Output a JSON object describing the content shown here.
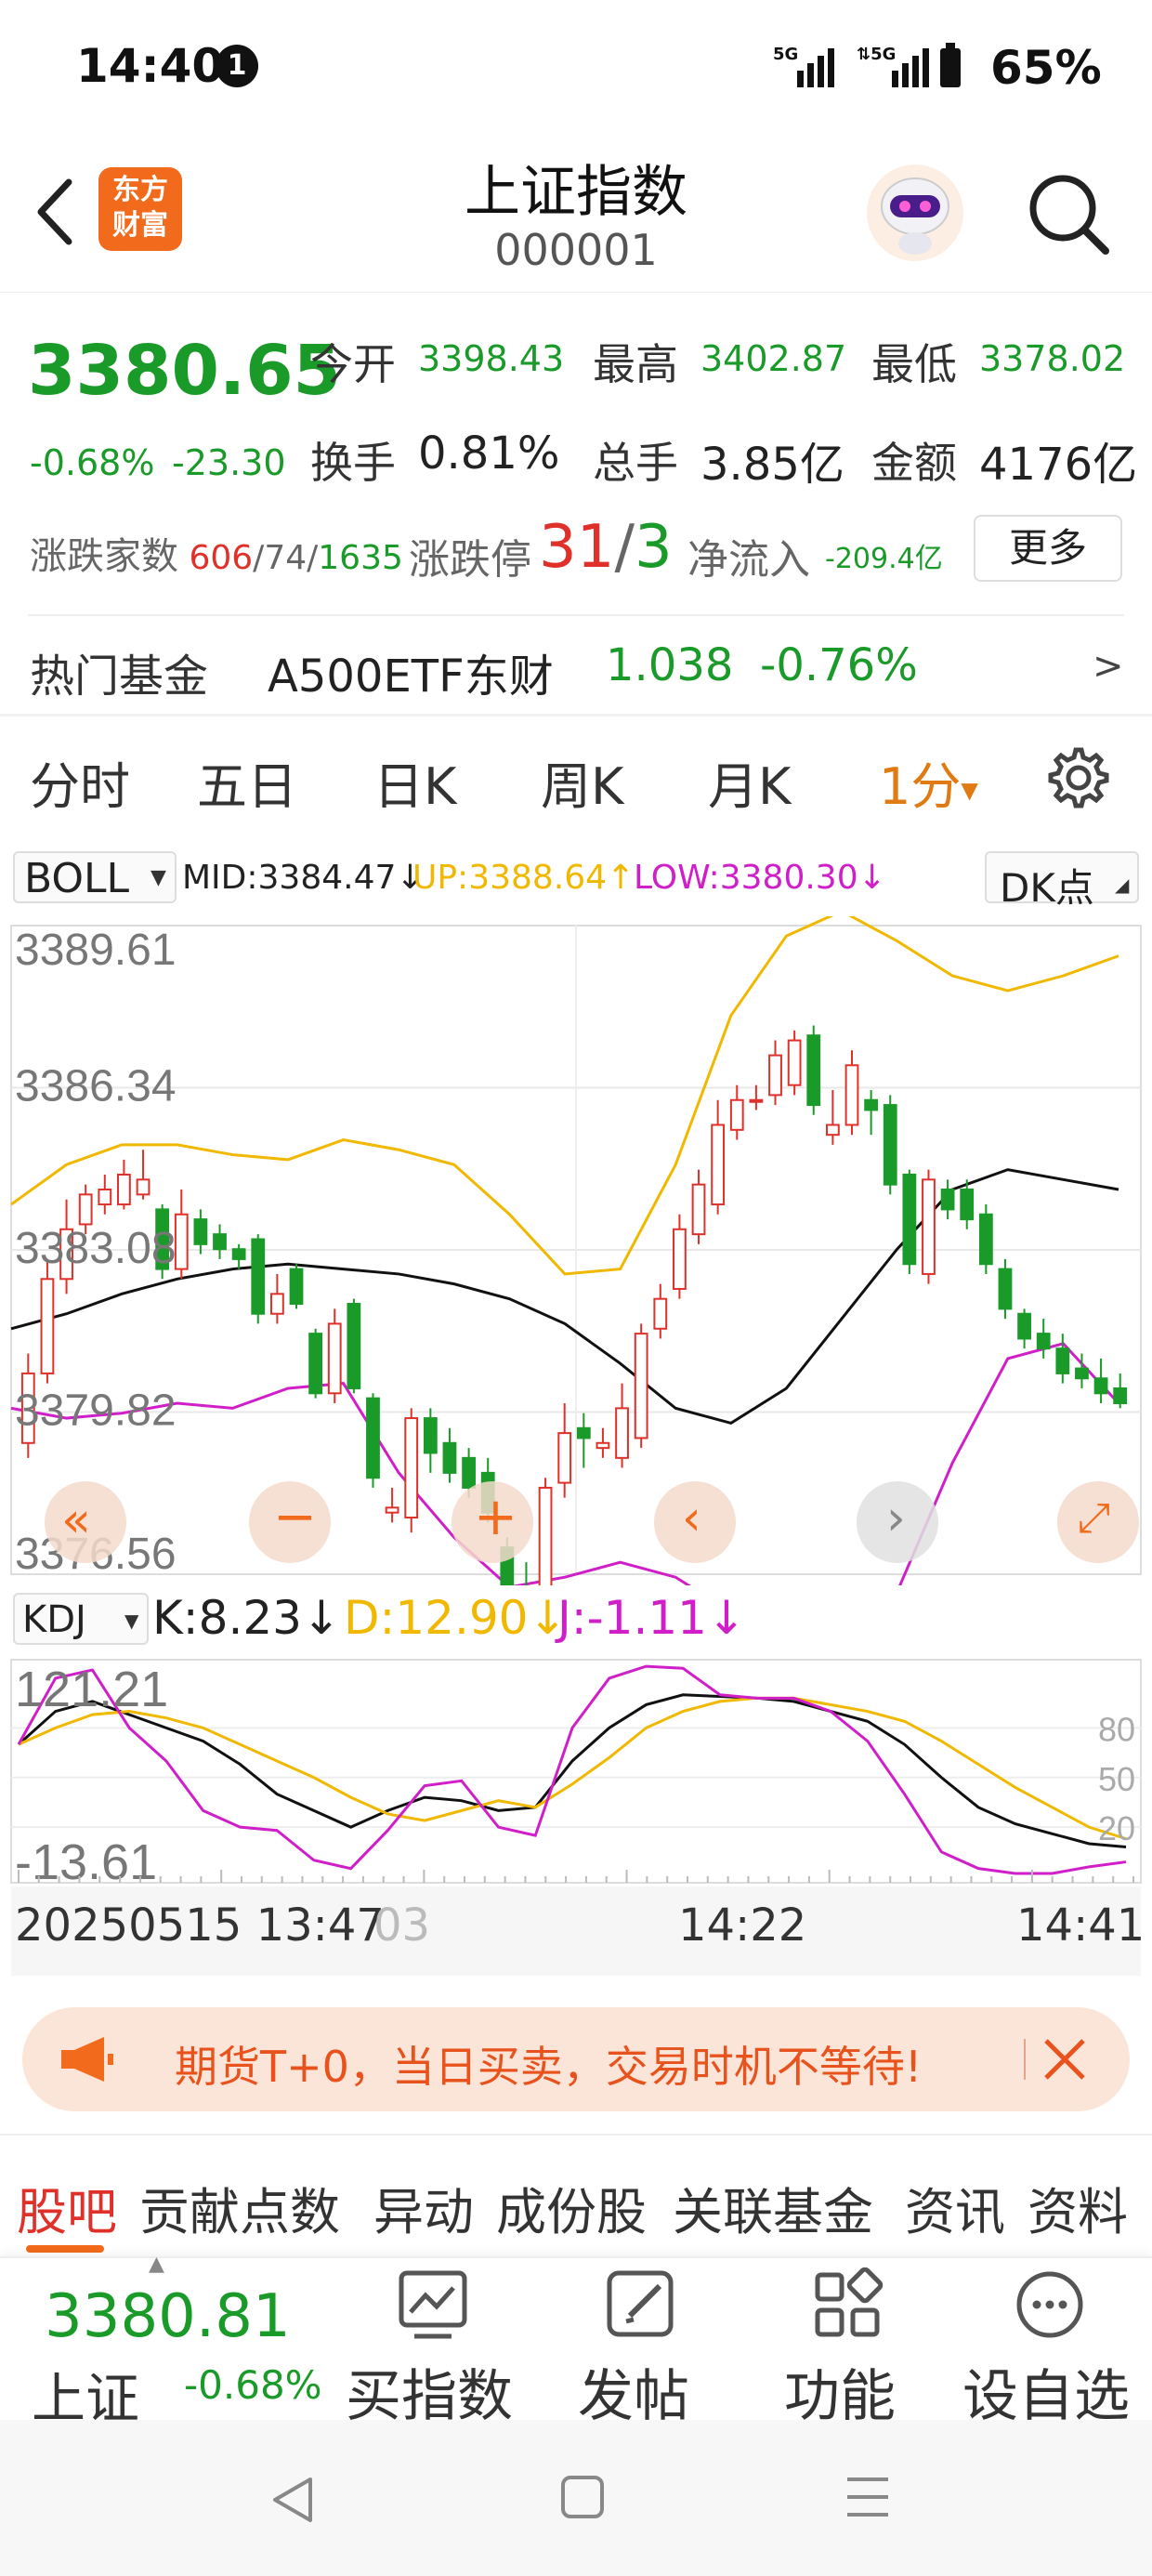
{
  "status": {
    "time": "14:40",
    "notif": "1",
    "net1": "5G",
    "net2": "5G",
    "battery": "65%"
  },
  "header": {
    "title": "上证指数",
    "code": "000001",
    "logo_line1": "东方",
    "logo_line2": "财富"
  },
  "quote": {
    "price": "3380.65",
    "change_pct": "-0.68%",
    "change": "-23.30",
    "open_label": "今开",
    "open": "3398.43",
    "high_label": "最高",
    "high": "3402.87",
    "low_label": "最低",
    "low": "3378.02",
    "turnover_label": "换手",
    "turnover": "0.81%",
    "volume_label": "总手",
    "volume": "3.85亿",
    "amount_label": "金额",
    "amount": "4176亿",
    "breadth_label": "涨跌家数",
    "up_count": "606",
    "flat_count": "74",
    "down_count": "1635",
    "sep": "/",
    "limit_label": "涨跌停",
    "limit_up": "31",
    "limit_down": "3",
    "netflow_label": "净流入",
    "netflow": "-209.4亿",
    "more_button": "更多"
  },
  "fund": {
    "label": "热门基金",
    "name": "A500ETF东财",
    "price": "1.038",
    "change": "-0.76%",
    "arrow": ">"
  },
  "tabs": [
    "分时",
    "五日",
    "日K",
    "周K",
    "月K",
    "1分"
  ],
  "tab_active_marker": "▼",
  "boll": {
    "name": "BOLL",
    "mid": "MID:3384.47↓",
    "up": "UP:3388.64↑",
    "low": "LOW:3380.30↓",
    "dk_button": "DK点"
  },
  "kdj": {
    "name": "KDJ",
    "k": "K:8.23↓",
    "d": "D:12.90↓",
    "j": "J:-1.11↓"
  },
  "time_axis": {
    "start": "20250515 13:47",
    "ghost": "03",
    "mid": "14:22",
    "end": "14:41"
  },
  "banner": {
    "text": "期货T+0，当日买卖，交易时机不等待!"
  },
  "subnav": [
    "股吧",
    "贡献点数",
    "异动",
    "成份股",
    "关联基金",
    "资讯",
    "资料"
  ],
  "bottom": {
    "price": "3380.81",
    "name": "上证",
    "change": "-0.68%",
    "items": [
      "买指数",
      "发帖",
      "功能",
      "设自选"
    ]
  },
  "colors": {
    "up": "#e0302a",
    "down": "#1a9a28",
    "mid": "#111111",
    "upper": "#f0b800",
    "lower": "#d01fc8",
    "accent": "#e07a12"
  },
  "chart_data": [
    {
      "type": "candlestick",
      "title": "BOLL",
      "yticks": [
        "3389.61",
        "3386.34",
        "3383.08",
        "3379.82",
        "3376.56"
      ],
      "ylim": [
        3376.56,
        3389.61
      ],
      "candles": [
        {
          "o": 3379.2,
          "c": 3380.6,
          "h": 3381.0,
          "l": 3378.9
        },
        {
          "o": 3380.6,
          "c": 3382.5,
          "h": 3382.9,
          "l": 3380.4
        },
        {
          "o": 3382.5,
          "c": 3383.5,
          "h": 3384.1,
          "l": 3382.2
        },
        {
          "o": 3383.6,
          "c": 3384.2,
          "h": 3384.4,
          "l": 3383.4
        },
        {
          "o": 3384.0,
          "c": 3384.3,
          "h": 3384.6,
          "l": 3383.8
        },
        {
          "o": 3384.0,
          "c": 3384.6,
          "h": 3384.9,
          "l": 3383.9
        },
        {
          "o": 3384.2,
          "c": 3384.5,
          "h": 3385.1,
          "l": 3384.1
        },
        {
          "o": 3383.9,
          "c": 3382.7,
          "h": 3384.0,
          "l": 3382.5
        },
        {
          "o": 3382.7,
          "c": 3383.8,
          "h": 3384.3,
          "l": 3382.5
        },
        {
          "o": 3383.7,
          "c": 3383.2,
          "h": 3383.9,
          "l": 3383.0
        },
        {
          "o": 3383.4,
          "c": 3383.1,
          "h": 3383.6,
          "l": 3382.9
        },
        {
          "o": 3383.1,
          "c": 3382.9,
          "h": 3383.2,
          "l": 3382.7
        },
        {
          "o": 3383.3,
          "c": 3381.8,
          "h": 3383.4,
          "l": 3381.6
        },
        {
          "o": 3381.8,
          "c": 3382.2,
          "h": 3382.6,
          "l": 3381.6
        },
        {
          "o": 3382.7,
          "c": 3382.0,
          "h": 3382.8,
          "l": 3381.9
        },
        {
          "o": 3381.4,
          "c": 3380.2,
          "h": 3381.5,
          "l": 3380.1
        },
        {
          "o": 3380.2,
          "c": 3381.6,
          "h": 3381.9,
          "l": 3380.0
        },
        {
          "o": 3382.0,
          "c": 3380.3,
          "h": 3382.1,
          "l": 3380.2
        },
        {
          "o": 3380.1,
          "c": 3378.5,
          "h": 3380.2,
          "l": 3378.3
        },
        {
          "o": 3377.8,
          "c": 3377.9,
          "h": 3378.3,
          "l": 3377.6
        },
        {
          "o": 3377.7,
          "c": 3379.7,
          "h": 3379.9,
          "l": 3377.4
        },
        {
          "o": 3379.7,
          "c": 3379.0,
          "h": 3379.9,
          "l": 3378.6
        },
        {
          "o": 3379.2,
          "c": 3378.6,
          "h": 3379.5,
          "l": 3378.4
        },
        {
          "o": 3378.9,
          "c": 3378.3,
          "h": 3379.1,
          "l": 3378.1
        },
        {
          "o": 3378.6,
          "c": 3377.8,
          "h": 3378.9,
          "l": 3377.6
        },
        {
          "o": 3377.1,
          "c": 3376.2,
          "h": 3377.3,
          "l": 3376.1
        },
        {
          "o": 3376.1,
          "c": 3375.9,
          "h": 3376.8,
          "l": 3375.8
        },
        {
          "o": 3375.8,
          "c": 3378.3,
          "h": 3378.5,
          "l": 3375.6
        },
        {
          "o": 3378.4,
          "c": 3379.4,
          "h": 3380.0,
          "l": 3378.1
        },
        {
          "o": 3379.5,
          "c": 3379.3,
          "h": 3379.8,
          "l": 3378.7
        },
        {
          "o": 3379.1,
          "c": 3379.2,
          "h": 3379.5,
          "l": 3378.9
        },
        {
          "o": 3378.9,
          "c": 3379.9,
          "h": 3380.4,
          "l": 3378.7
        },
        {
          "o": 3379.3,
          "c": 3381.4,
          "h": 3381.6,
          "l": 3379.1
        },
        {
          "o": 3381.5,
          "c": 3382.1,
          "h": 3382.4,
          "l": 3381.3
        },
        {
          "o": 3382.3,
          "c": 3383.5,
          "h": 3383.8,
          "l": 3382.1
        },
        {
          "o": 3383.4,
          "c": 3384.4,
          "h": 3384.7,
          "l": 3383.2
        },
        {
          "o": 3384.0,
          "c": 3385.6,
          "h": 3386.1,
          "l": 3383.8
        },
        {
          "o": 3385.5,
          "c": 3386.1,
          "h": 3386.4,
          "l": 3385.3
        },
        {
          "o": 3386.1,
          "c": 3386.1,
          "h": 3386.4,
          "l": 3385.9
        },
        {
          "o": 3386.2,
          "c": 3387.0,
          "h": 3387.3,
          "l": 3386.0
        },
        {
          "o": 3386.4,
          "c": 3387.3,
          "h": 3387.5,
          "l": 3386.2
        },
        {
          "o": 3387.4,
          "c": 3386.0,
          "h": 3387.6,
          "l": 3385.8
        },
        {
          "o": 3385.4,
          "c": 3385.6,
          "h": 3386.3,
          "l": 3385.2
        },
        {
          "o": 3385.6,
          "c": 3386.8,
          "h": 3387.1,
          "l": 3385.4
        },
        {
          "o": 3386.1,
          "c": 3385.9,
          "h": 3386.3,
          "l": 3385.4
        },
        {
          "o": 3386.0,
          "c": 3384.4,
          "h": 3386.2,
          "l": 3384.2
        },
        {
          "o": 3384.6,
          "c": 3382.8,
          "h": 3384.7,
          "l": 3382.6
        },
        {
          "o": 3382.6,
          "c": 3384.5,
          "h": 3384.7,
          "l": 3382.4
        },
        {
          "o": 3384.3,
          "c": 3383.9,
          "h": 3384.5,
          "l": 3383.7
        },
        {
          "o": 3384.3,
          "c": 3383.7,
          "h": 3384.5,
          "l": 3383.5
        },
        {
          "o": 3383.8,
          "c": 3382.8,
          "h": 3384.0,
          "l": 3382.6
        },
        {
          "o": 3382.7,
          "c": 3381.9,
          "h": 3382.9,
          "l": 3381.7
        },
        {
          "o": 3381.8,
          "c": 3381.3,
          "h": 3381.9,
          "l": 3381.1
        },
        {
          "o": 3381.4,
          "c": 3381.1,
          "h": 3381.7,
          "l": 3380.9
        },
        {
          "o": 3381.1,
          "c": 3380.6,
          "h": 3381.4,
          "l": 3380.4
        },
        {
          "o": 3380.7,
          "c": 3380.5,
          "h": 3381.0,
          "l": 3380.3
        },
        {
          "o": 3380.5,
          "c": 3380.2,
          "h": 3380.9,
          "l": 3380.0
        },
        {
          "o": 3380.3,
          "c": 3380.0,
          "h": 3380.6,
          "l": 3379.9
        }
      ],
      "mid": [
        3381.5,
        3381.8,
        3382.2,
        3382.5,
        3382.7,
        3382.8,
        3382.7,
        3382.6,
        3382.4,
        3382.1,
        3381.6,
        3380.8,
        3379.9,
        3379.6,
        3380.3,
        3381.7,
        3383.1,
        3384.3,
        3384.7,
        3384.5,
        3384.3
      ],
      "upper": [
        3384.0,
        3384.8,
        3385.2,
        3385.2,
        3385.0,
        3384.9,
        3385.3,
        3385.1,
        3384.8,
        3383.8,
        3382.6,
        3382.7,
        3384.8,
        3387.8,
        3389.4,
        3389.9,
        3389.3,
        3388.6,
        3388.3,
        3388.6,
        3389.0
      ],
      "lower": [
        3379.9,
        3379.7,
        3379.8,
        3380.0,
        3379.9,
        3380.3,
        3380.4,
        3378.6,
        3377.3,
        3376.3,
        3376.5,
        3376.8,
        3376.5,
        3375.8,
        3375.3,
        3375.4,
        3376.2,
        3378.8,
        3380.9,
        3381.2,
        3380.0
      ]
    },
    {
      "type": "line",
      "title": "KDJ",
      "yticks_left": [
        "121.21",
        "-13.61"
      ],
      "yticks_right": [
        "80",
        "50",
        "20"
      ],
      "ylim": [
        -13.61,
        121.21
      ],
      "series": [
        {
          "name": "K",
          "values": [
            70,
            90,
            96,
            88,
            80,
            72,
            58,
            40,
            30,
            20,
            30,
            38,
            36,
            30,
            32,
            60,
            80,
            94,
            100,
            99,
            98,
            96,
            90,
            84,
            70,
            50,
            32,
            22,
            16,
            10,
            8
          ]
        },
        {
          "name": "D",
          "values": [
            70,
            80,
            88,
            90,
            86,
            80,
            70,
            60,
            50,
            38,
            28,
            24,
            30,
            36,
            32,
            46,
            62,
            80,
            90,
            96,
            98,
            98,
            94,
            90,
            84,
            72,
            58,
            44,
            32,
            20,
            13
          ]
        },
        {
          "name": "J",
          "values": [
            70,
            110,
            115,
            80,
            60,
            30,
            20,
            18,
            0,
            -5,
            18,
            45,
            48,
            20,
            15,
            80,
            110,
            118,
            116,
            100,
            98,
            98,
            90,
            72,
            40,
            5,
            -5,
            -8,
            -8,
            -4,
            -1
          ]
        }
      ]
    }
  ]
}
